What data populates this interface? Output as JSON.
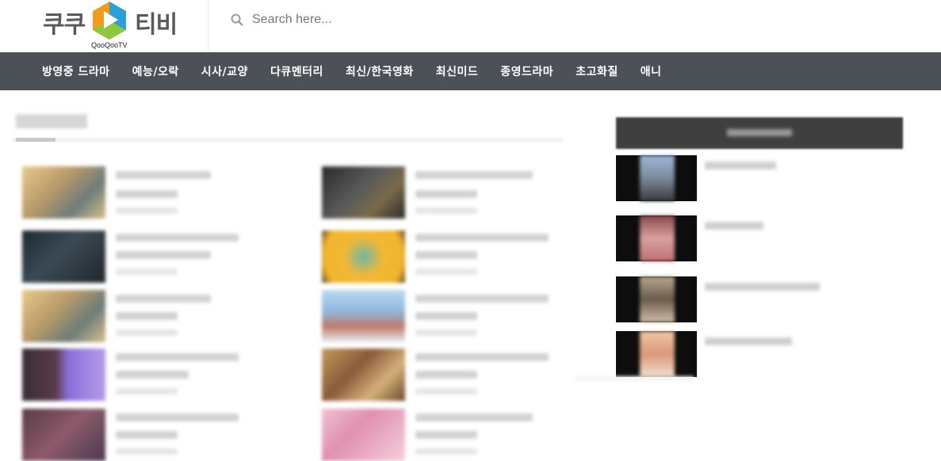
{
  "header": {
    "logo_left": "쿠쿠",
    "logo_right": "티비",
    "logo_sub": "QooQooTV",
    "search_placeholder": "Search here..."
  },
  "nav": {
    "items": [
      "방영중 드라마",
      "예능/오락",
      "시사/교양",
      "다큐멘터리",
      "최신/한국영화",
      "최신미드",
      "종영드라마",
      "초고화질",
      "애니"
    ]
  },
  "colors": {
    "nav_bg": "#4b5156",
    "logo_orange": "#f29a1f",
    "logo_green": "#8dc63f",
    "logo_blue": "#2a9fd8",
    "widget_head_bg": "#3f3f3f"
  },
  "icons": {
    "search": "search-icon",
    "logo": "play-logo-icon"
  }
}
